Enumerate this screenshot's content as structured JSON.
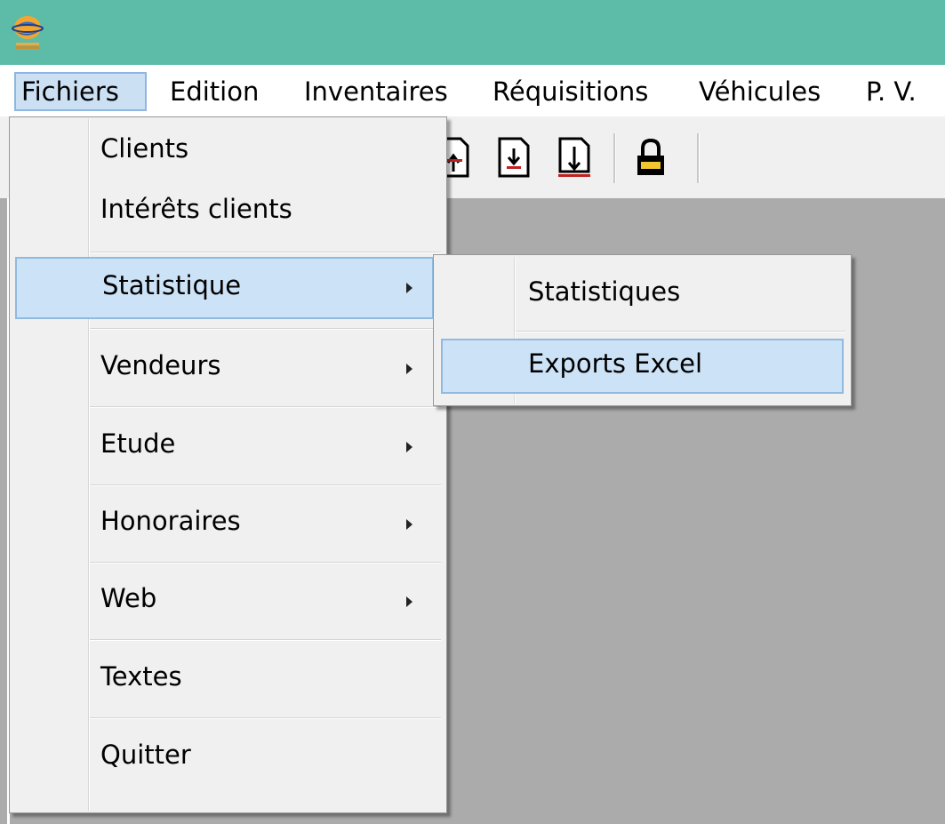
{
  "menubar": {
    "items": [
      "Fichiers",
      "Edition",
      "Inventaires",
      "Réquisitions",
      "Véhicules",
      "P. V."
    ],
    "active": "Fichiers"
  },
  "toolbar": {
    "icons": [
      "document-up-icon",
      "document-import-icon",
      "document-export-icon",
      "lock-icon"
    ]
  },
  "fichiers_menu": {
    "items": [
      {
        "label": "Clients"
      },
      {
        "label": "Intérêts clients"
      },
      {
        "label": "Statistique",
        "submenu": true,
        "highlighted": true
      },
      {
        "label": "Vendeurs",
        "submenu": true
      },
      {
        "label": "Etude",
        "submenu": true
      },
      {
        "label": "Honoraires",
        "submenu": true
      },
      {
        "label": "Web",
        "submenu": true
      },
      {
        "label": "Textes"
      },
      {
        "label": "Quitter"
      }
    ]
  },
  "statistique_submenu": {
    "items": [
      {
        "label": "Statistiques"
      },
      {
        "label": "Exports Excel",
        "highlighted": true
      }
    ]
  },
  "colors": {
    "titlebar": "#5cbca8",
    "highlight": "#cce2f6",
    "highlight_border": "#91badf",
    "client_area": "#ababab"
  }
}
